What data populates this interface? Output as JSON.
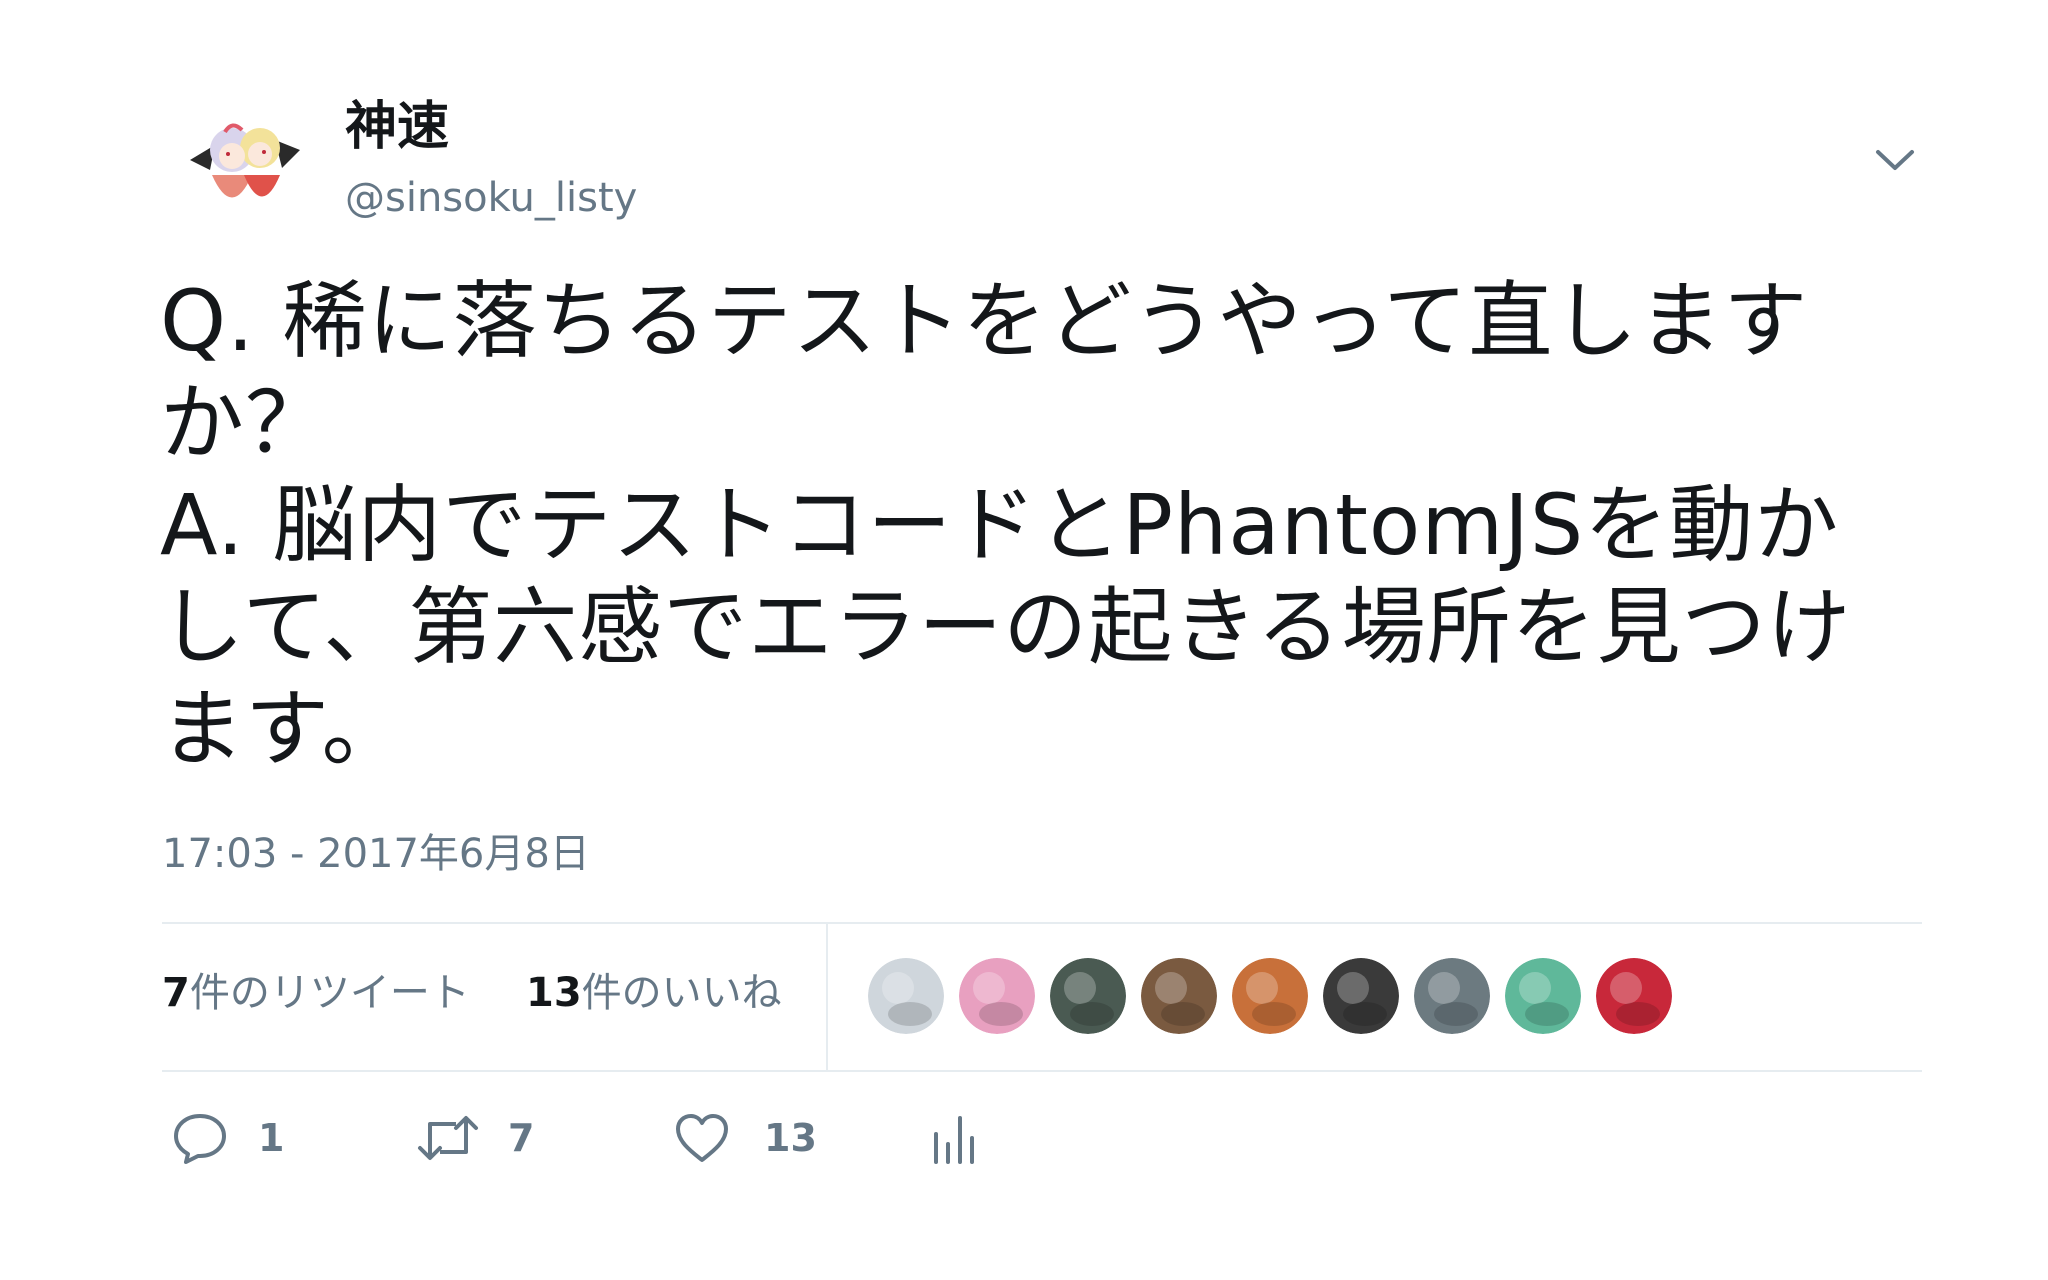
{
  "user": {
    "display_name": "神速",
    "handle": "@sinsoku_listy",
    "avatar_icon": "avatar-anime-illustration"
  },
  "tweet": {
    "text": "Q. 稀に落ちるテストをどうやって直しますか？\nA. 脳内でテストコードとPhantomJSを動かして、第六感でエラーの起きる場所を見つけます。",
    "timestamp": "17:03 - 2017年6月8日"
  },
  "stats": {
    "retweet_count": "7",
    "retweet_label": "件のリツイート",
    "like_count": "13",
    "like_label": "件のいいね"
  },
  "likers": [
    {
      "icon": "liker-avatar-swirl",
      "color": "#cfd6dc"
    },
    {
      "icon": "liker-avatar-anime-girl",
      "color": "#e8a0c0"
    },
    {
      "icon": "liker-avatar-workspace",
      "color": "#4a5a52"
    },
    {
      "icon": "liker-avatar-person",
      "color": "#7a5a40"
    },
    {
      "icon": "liker-avatar-fox",
      "color": "#c8703a"
    },
    {
      "icon": "liker-avatar-person-dark",
      "color": "#3a3a3a"
    },
    {
      "icon": "liker-avatar-device",
      "color": "#6c7a80"
    },
    {
      "icon": "liker-avatar-green-creature",
      "color": "#5fb89a"
    },
    {
      "icon": "liker-avatar-red-shoes",
      "color": "#c8283a"
    }
  ],
  "actions": {
    "reply_count": "1",
    "retweet_count": "7",
    "like_count": "13"
  },
  "colors": {
    "text_primary": "#14171a",
    "text_secondary": "#657786",
    "divider": "#e6ecf0"
  }
}
